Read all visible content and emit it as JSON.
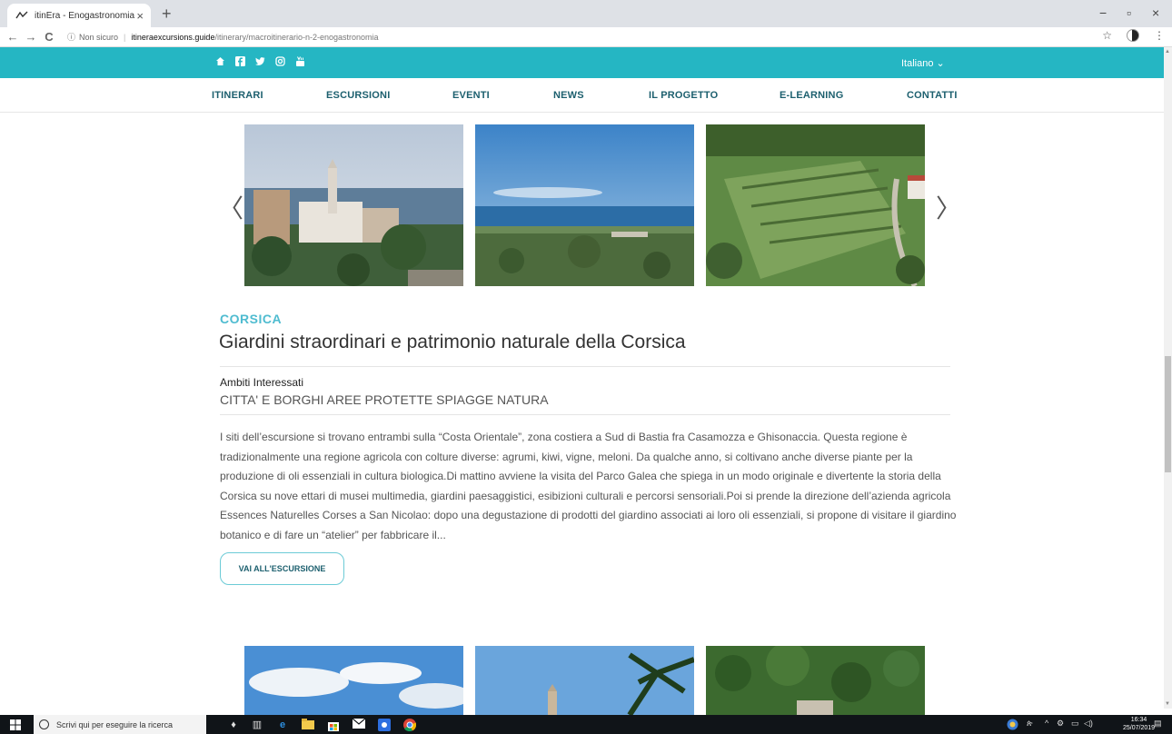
{
  "browser": {
    "tab_title": "itinEra - Enogastronomia",
    "tab_close": "×",
    "new_tab": "+",
    "window_controls": {
      "minimize": "−",
      "restore": "▫",
      "close": "×"
    },
    "nav": {
      "back": "←",
      "forward": "→",
      "reload": "C"
    },
    "url": {
      "info_icon": "ⓘ",
      "security_label": "Non sicuro",
      "host": "itineraexcursions.guide",
      "path": "/itinerary/macroitinerario-n-2-enogastronomia"
    },
    "star_icon": "☆",
    "menu_icon": "⋮"
  },
  "site": {
    "social_icons": [
      "home-icon",
      "facebook-icon",
      "twitter-icon",
      "instagram-icon",
      "youtube-icon"
    ],
    "language": "Italiano ⌄",
    "nav": [
      "ITINERARI",
      "ESCURSIONI",
      "EVENTI",
      "NEWS",
      "IL PROGETTO",
      "E-LEARNING",
      "CONTATTI"
    ],
    "carousel": {
      "prev": "〈",
      "next": "〉"
    },
    "excursion": {
      "region": "CORSICA",
      "title": "Giardini straordinari e patrimonio naturale della Corsica",
      "ambiti_label": "Ambiti Interessati",
      "ambiti_values": "CITTA' E BORGHI AREE PROTETTE SPIAGGE NATURA",
      "description": "I siti dell’escursione si trovano entrambi sulla “Costa Orientale”, zona costiera a Sud di Bastia fra Casamozza e Ghisonaccia. Questa regione è tradizionalmente una regione agricola con colture diverse: agrumi, kiwi, vigne, meloni. Da qualche anno, si coltivano anche diverse piante per la produzione di oli essenziali in cultura biologica.Di mattino avviene la visita del Parco Galea che spiega in un modo originale e divertente la storia della Corsica su nove ettari di musei multimedia, giardini paesaggistici, esibizioni culturali e percorsi sensoriali.Poi si prende la direzione dell’azienda agricola Essences Naturelles Corses a San Nicolao: dopo una degustazione di prodotti del giardino associati ai loro oli essenziali, si propone di visitare il giardino botanico e di fare un “atelier” per fabbricare il...",
      "cta": "VAI ALL'ESCURSIONE"
    }
  },
  "taskbar": {
    "search_placeholder": "Scrivi qui per eseguire la ricerca",
    "time": "16:34",
    "date": "25/07/2019"
  },
  "colors": {
    "accent": "#25b6c3",
    "nav_text": "#1c5f6e",
    "region": "#4fbcd0"
  }
}
